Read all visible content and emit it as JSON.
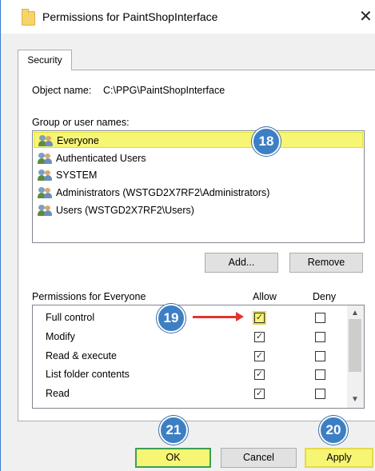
{
  "window": {
    "title": "Permissions for PaintShopInterface",
    "close_glyph": "✕"
  },
  "tabs": [
    {
      "label": "Security"
    }
  ],
  "object": {
    "label": "Object name:",
    "value": "C:\\PPG\\PaintShopInterface"
  },
  "groups": {
    "label": "Group or user names:",
    "items": [
      {
        "name": "Everyone",
        "selected": true
      },
      {
        "name": "Authenticated Users"
      },
      {
        "name": "SYSTEM"
      },
      {
        "name": "Administrators (WSTGD2X7RF2\\Administrators)"
      },
      {
        "name": "Users (WSTGD2X7RF2\\Users)"
      }
    ]
  },
  "buttons": {
    "add": "Add...",
    "remove": "Remove",
    "ok": "OK",
    "cancel": "Cancel",
    "apply": "Apply"
  },
  "permissions": {
    "label": "Permissions for Everyone",
    "allow_header": "Allow",
    "deny_header": "Deny",
    "rows": [
      {
        "name": "Full control",
        "allow": true,
        "deny": false
      },
      {
        "name": "Modify",
        "allow": true,
        "deny": false
      },
      {
        "name": "Read & execute",
        "allow": true,
        "deny": false
      },
      {
        "name": "List folder contents",
        "allow": true,
        "deny": false
      },
      {
        "name": "Read",
        "allow": true,
        "deny": false
      }
    ]
  },
  "callouts": {
    "c18": "18",
    "c19": "19",
    "c20": "20",
    "c21": "21"
  },
  "icons": {
    "check": "✓",
    "scroll_up": "▲",
    "scroll_down": "▼"
  },
  "colors": {
    "highlight": "#f7f574",
    "badge": "#3d7fc4",
    "arrow": "#e3342f",
    "ok_border": "#3b9e57"
  }
}
